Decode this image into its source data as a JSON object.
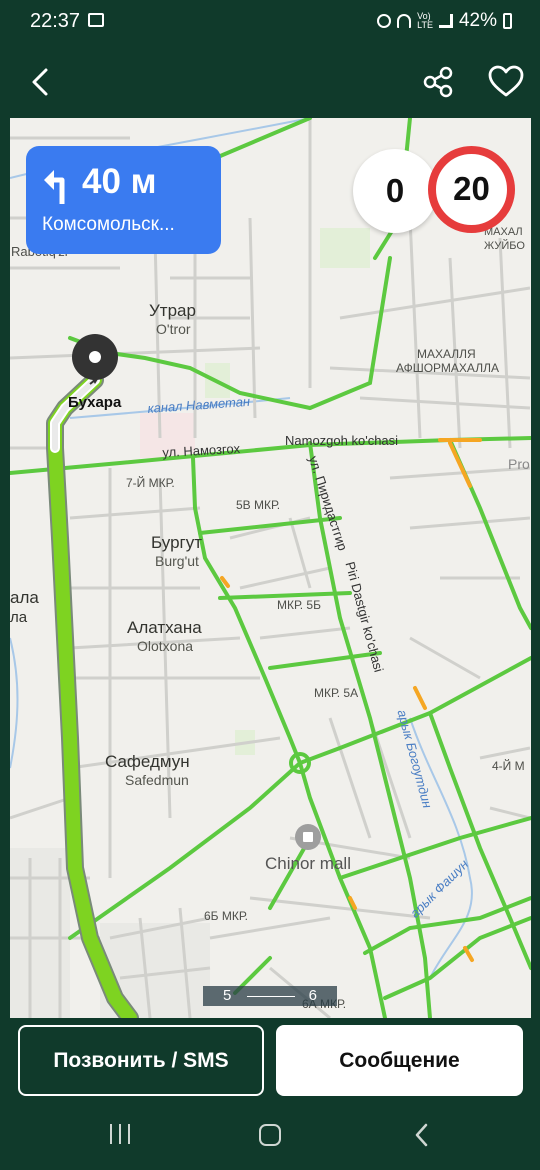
{
  "status_bar": {
    "time": "22:37",
    "battery": "42%",
    "icons": [
      "gallery-icon",
      "alarm-icon",
      "wifi-icon",
      "volte-icon",
      "signal-icon",
      "battery-icon"
    ]
  },
  "app_bar": {
    "icons": [
      "back-arrow-icon",
      "share-icon",
      "heart-icon"
    ]
  },
  "navigation": {
    "maneuver_icon": "turn-left-icon",
    "distance": "40 м",
    "street": "Комсомольск...",
    "current_speed": "0",
    "speed_limit": "20"
  },
  "map": {
    "labels": {
      "utrar": "Утрар",
      "utrar_latin": "O'tror",
      "mahalla": "МАХАЛЛЯ",
      "afshor": "АФШОРМАХАЛЛА",
      "rabotiq": "Rabotiq'zi",
      "mahal_right1": "МАХАЛ",
      "mahal_right2": "ЖУЙБО",
      "bukhara_pin": "Бухара",
      "canal_navmetan": "канал Навметан",
      "namozgoh_ru": "ул. Намозгох",
      "namozgoh_uz": "Namozgoh ko'chasi",
      "pro": "Pro",
      "mkr7": "7-Й МКР.",
      "mkr5v": "5В МКР.",
      "pirida_ru": "ул. Пиридастгир",
      "pirida_uz": "Piri Dastgir ko'chasi",
      "burgut": "Бургут",
      "burgut_latin": "Burg'ut",
      "ala": "ала",
      "ala2": "ла",
      "alathana": "Алатхана",
      "olotxona": "Olotxona",
      "mkr5b": "МКР. 5Б",
      "mkr5a": "МКР. 5А",
      "aryk_bogoutdin": "арык Богоутдин",
      "safedmun": "Сафедмун",
      "safedmun_latin": "Safedmun",
      "mkr4y": "4-Й М",
      "chinor_mall": "Chinor mall",
      "aryk_fashun": "арык Фашун",
      "mkr6b": "6Б МКР.",
      "mkr6a": "6А МКР."
    },
    "scale_from": "5",
    "scale_to": "6",
    "colors": {
      "route": "#7ed321",
      "traffic_green": "#5cc940",
      "traffic_orange": "#f5a623",
      "road": "#d4d4d0",
      "canal": "#a8c8e8",
      "background": "#f1f0ec"
    }
  },
  "actions": {
    "call_sms": "Позвонить / SMS",
    "message": "Сообщение"
  },
  "nav_bar": {
    "icons": [
      "recents-icon",
      "home-icon",
      "back-icon"
    ]
  }
}
